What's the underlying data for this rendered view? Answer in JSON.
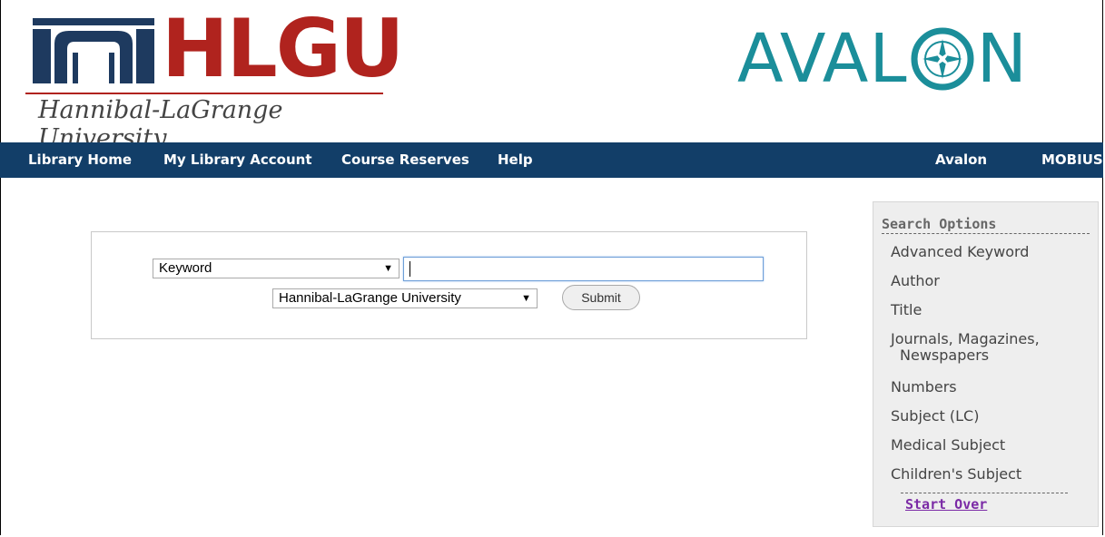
{
  "header": {
    "logo_letters": "HLGU",
    "logo_subtitle": "Hannibal-LaGrange University",
    "avalon_left": "AVAL",
    "avalon_right": "N",
    "colors": {
      "brand_red": "#b0231e",
      "brand_navy": "#1e3a5f",
      "avalon_teal": "#1b8e9a"
    }
  },
  "nav": {
    "items": [
      {
        "label": "Library Home"
      },
      {
        "label": "My Library Account"
      },
      {
        "label": "Course Reserves"
      },
      {
        "label": "Help"
      },
      {
        "label": "Avalon"
      },
      {
        "label": "MOBIUS"
      }
    ],
    "background": "#123e68"
  },
  "search": {
    "type_select": "Keyword",
    "library_select": "Hannibal-LaGrange University",
    "query_value": "",
    "submit_label": "Submit"
  },
  "sidebar": {
    "title": "Search Options",
    "items": [
      {
        "label": "Advanced Keyword"
      },
      {
        "label": "Author"
      },
      {
        "label": "Title"
      },
      {
        "label": "Journals, Magazines, Newspapers"
      },
      {
        "label": "Numbers"
      },
      {
        "label": "Subject (LC)"
      },
      {
        "label": "Medical Subject"
      },
      {
        "label": "Children's Subject"
      }
    ],
    "start_over": "Start Over"
  }
}
